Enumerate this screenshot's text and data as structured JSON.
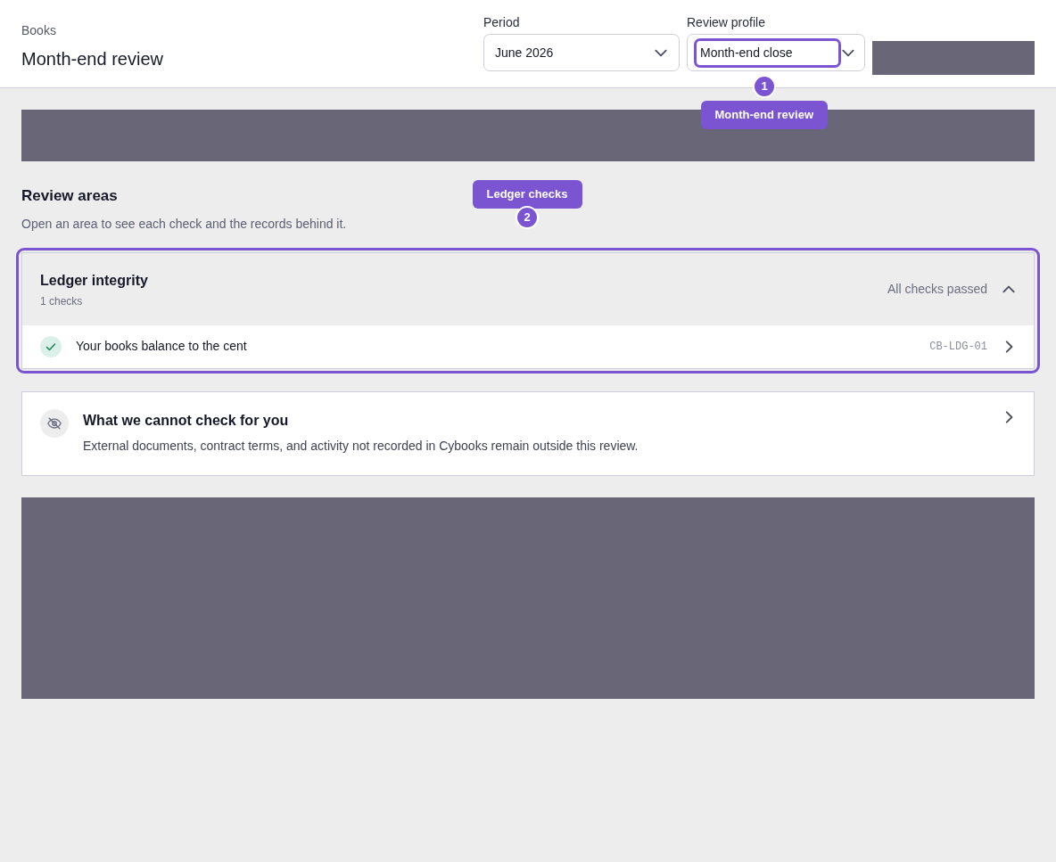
{
  "header": {
    "breadcrumb": "Books",
    "title": "Month-end review",
    "filters": [
      {
        "label": "Period",
        "value": "June 2026",
        "highlighted": false
      },
      {
        "label": "Review profile",
        "value": "Month-end close",
        "highlighted": true
      }
    ]
  },
  "section": {
    "title": "Review areas",
    "subtitle": "Open an area to see each check and the records behind it."
  },
  "areas": [
    {
      "kind": "group",
      "title": "Ledger integrity",
      "count": "1 checks",
      "status": "All checks passed",
      "expanded": true,
      "highlighted": true,
      "checks": [
        {
          "label": "Your books balance to the cent",
          "code": "CB-LDG-01",
          "passed": true
        }
      ]
    },
    {
      "kind": "note",
      "title": "What we cannot check for you",
      "text": "External documents, contract terms, and activity not recorded in Cybooks remain outside this review."
    }
  ],
  "tour_steps": [
    {
      "number": "1",
      "label": "Month-end review"
    },
    {
      "number": "2",
      "label": "Ledger checks"
    }
  ]
}
